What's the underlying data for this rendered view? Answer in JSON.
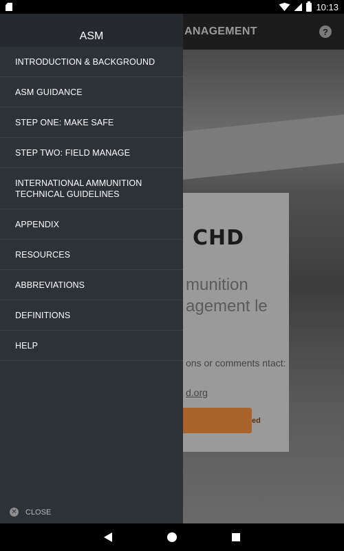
{
  "status_bar": {
    "time": "10:13",
    "battery_icon": "battery-charging-icon"
  },
  "app": {
    "title": "ANAGEMENT",
    "card": {
      "logo_text": "CHD",
      "heading": "munition agement le",
      "body_text": "ons or comments ntact:",
      "link_text": "d.org",
      "button_label": "ed"
    }
  },
  "drawer": {
    "header_title": "ASM",
    "items": [
      {
        "label": "INTRODUCTION & BACKGROUND"
      },
      {
        "label": "ASM GUIDANCE"
      },
      {
        "label": "STEP ONE: MAKE SAFE"
      },
      {
        "label": "STEP TWO: FIELD MANAGE"
      },
      {
        "label": "INTERNATIONAL AMMUNITION\nTECHNICAL GUIDELINES"
      },
      {
        "label": "APPENDIX"
      },
      {
        "label": "RESOURCES"
      },
      {
        "label": "ABBREVIATIONS"
      },
      {
        "label": "DEFINITIONS"
      },
      {
        "label": "HELP"
      }
    ],
    "close_label": "CLOSE"
  },
  "colors": {
    "drawer_bg": "#2d3237",
    "accent_button": "#a9642c"
  }
}
